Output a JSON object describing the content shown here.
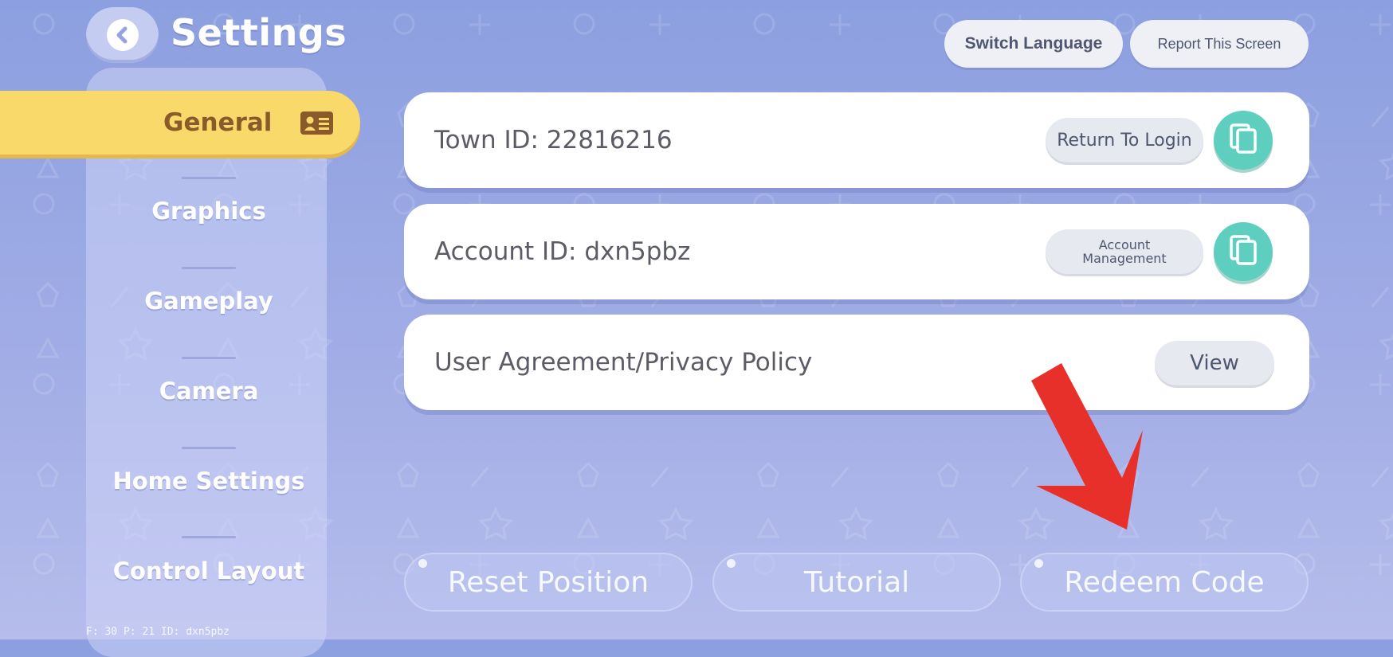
{
  "header": {
    "title": "Settings",
    "back_icon": "chevron-left-icon",
    "switch_language_label": "Switch Language",
    "report_screen_label": "Report This Screen"
  },
  "sidebar": {
    "items": [
      {
        "label": "General",
        "active": true,
        "icon": "id-card-icon"
      },
      {
        "label": "Graphics",
        "active": false
      },
      {
        "label": "Gameplay",
        "active": false
      },
      {
        "label": "Camera",
        "active": false
      },
      {
        "label": "Home Settings",
        "active": false
      },
      {
        "label": "Control Layout",
        "active": false
      }
    ]
  },
  "main": {
    "town_id": {
      "text": "Town ID: 22816216",
      "button_label": "Return To Login",
      "copy_icon": "copy-icon"
    },
    "account_id": {
      "text": "Account ID: dxn5pbz",
      "button_label_line1": "Account",
      "button_label_line2": "Management",
      "copy_icon": "copy-icon"
    },
    "policy": {
      "text": "User Agreement/Privacy Policy",
      "button_label": "View"
    }
  },
  "bottom_buttons": {
    "reset_position": "Reset Position",
    "tutorial": "Tutorial",
    "redeem_code": "Redeem Code"
  },
  "debug": {
    "text": "F: 30    P: 21    ID: dxn5pbz"
  },
  "colors": {
    "background": "#8c9fe0",
    "active_tab": "#f8d96a",
    "copy_button": "#5ecfbe",
    "arrow": "#e8302a"
  }
}
